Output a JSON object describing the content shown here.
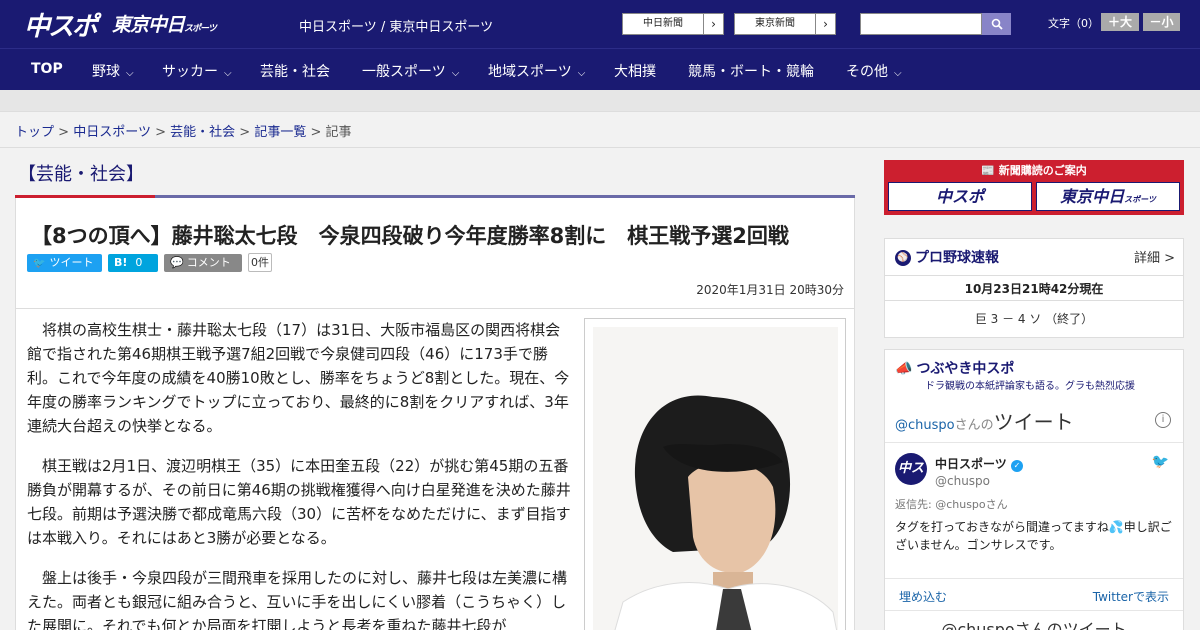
{
  "header": {
    "logo_main": "中スポ",
    "logo_tokyo": "東京中日",
    "logo_tokyo_small": "スポーツ",
    "site_links": "中日スポーツ / 東京中日スポーツ",
    "paper_links": [
      "中日新聞",
      "東京新聞"
    ],
    "font_size_label": "文字（0）",
    "font_larger": "＋大",
    "font_smaller": "－小"
  },
  "nav": [
    {
      "label": "TOP",
      "chevron": false
    },
    {
      "label": "野球",
      "chevron": true
    },
    {
      "label": "サッカー",
      "chevron": true
    },
    {
      "label": "芸能・社会",
      "chevron": false
    },
    {
      "label": "一般スポーツ",
      "chevron": true
    },
    {
      "label": "地域スポーツ",
      "chevron": true
    },
    {
      "label": "大相撲",
      "chevron": false
    },
    {
      "label": "競馬・ボート・競輪",
      "chevron": false
    },
    {
      "label": "その他",
      "chevron": true
    }
  ],
  "breadcrumb": {
    "items": [
      "トップ",
      "中日スポーツ",
      "芸能・社会",
      "記事一覧"
    ],
    "current": "記事",
    "separator": ">"
  },
  "article": {
    "category": "【芸能・社会】",
    "title": "【8つの頂へ】藤井聡太七段　今泉四段破り今年度勝率8割に　棋王戦予選2回戦",
    "share": {
      "tweet": "ツイート",
      "hatena": "B!",
      "hatena_count": "0",
      "comment": "コメント",
      "comment_count": "0件"
    },
    "date": "2020年1月31日 20時30分",
    "paragraphs": [
      "将棋の高校生棋士・藤井聡太七段（17）は31日、大阪市福島区の関西将棋会館で指された第46期棋王戦予選7組2回戦で今泉健司四段（46）に173手で勝利。これで今年度の成績を40勝10敗とし、勝率をちょうど8割とした。現在、今年度の勝率ランキングでトップに立っており、最終的に8割をクリアすれば、3年連続大台超えの快挙となる。",
      "棋王戦は2月1日、渡辺明棋王（35）に本田奎五段（22）が挑む第45期の五番勝負が開幕するが、その前日に第46期の挑戦権獲得へ向け白星発進を決めた藤井七段。前期は予選決勝で都成竜馬六段（30）に苦杯をなめただけに、まず目指すは本戦入り。それにはあと3勝が必要となる。",
      "盤上は後手・今泉四段が三間飛車を採用したのに対し、藤井七段は左美濃に構えた。両者とも銀冠に組み合うと、互いに手を出しにくい膠着（こうちゃく）した展開に。それでも何とか局面を打開しようと長考を重ねた藤井七段が"
    ]
  },
  "sidebar": {
    "ad": {
      "heading": "新聞購読のご案内",
      "logo_main": "中スポ",
      "logo_tokyo": "東京中日",
      "logo_tokyo_small": "スポーツ"
    },
    "baseball": {
      "title": "プロ野球速報",
      "details": "詳細 >",
      "timestamp": "10月23日21時42分現在",
      "score": "巨 3 － 4 ソ （終了）"
    },
    "twitter": {
      "title": "つぶやき中スポ",
      "subtitle": "ドラ観戦の本紙評論家も語る。グラも熱烈応援",
      "handle_prefix": "@chuspo",
      "handle_suffix": "さんの",
      "tweets_word": "ツイート",
      "account_name": "中日スポーツ",
      "account_handle": "@chuspo",
      "reply_to": "返信先: @chuspoさん",
      "tweet_text": "タグを打っておきながら間違ってますね💦申し訳ございません。ゴンサレスです。",
      "embed": "埋め込む",
      "view_on_twitter": "Twitterで表示",
      "footer": "@chuspoさんのツイート"
    }
  },
  "colors": {
    "navy": "#1a1a72",
    "red": "#cc1f2f",
    "twitter_blue": "#1da1f2",
    "hatena_blue": "#00a4de"
  }
}
